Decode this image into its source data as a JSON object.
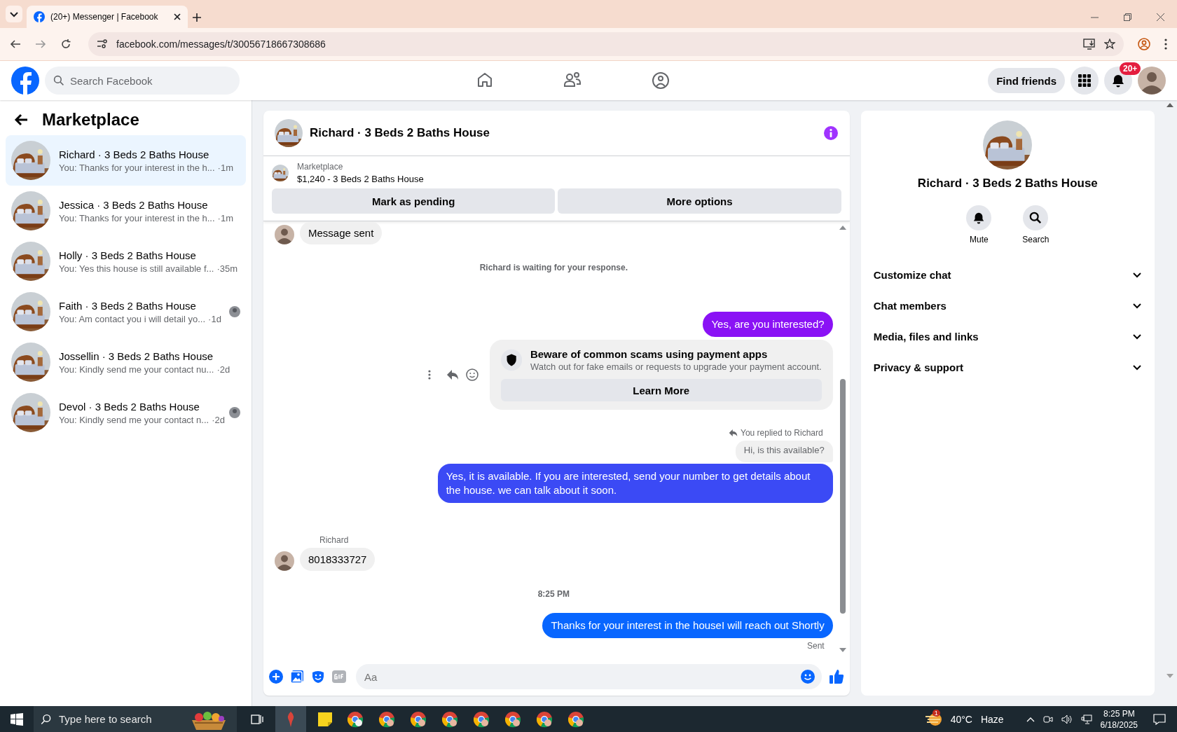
{
  "browser": {
    "tab_title": "(20+) Messenger | Facebook",
    "url": "facebook.com/messages/t/30056718667308686"
  },
  "header": {
    "search_placeholder": "Search Facebook",
    "find_friends": "Find friends",
    "notification_badge": "20+"
  },
  "sidebar": {
    "title": "Marketplace",
    "conversations": [
      {
        "name": "Richard · 3 Beds 2 Baths House",
        "preview": "You: Thanks for your interest in the h...",
        "time": "·1m",
        "selected": true,
        "seen": false
      },
      {
        "name": "Jessica · 3 Beds 2 Baths House",
        "preview": "You: Thanks for your interest in the h...",
        "time": "·1m",
        "selected": false,
        "seen": false
      },
      {
        "name": "Holly · 3 Beds 2 Baths House",
        "preview": "You: Yes this house is still available f...",
        "time": "·35m",
        "selected": false,
        "seen": false
      },
      {
        "name": "Faith · 3 Beds 2 Baths House",
        "preview": "You: Am contact you i will detail yo...",
        "time": "·1d",
        "selected": false,
        "seen": true
      },
      {
        "name": "Jossellin · 3 Beds 2 Baths House",
        "preview": "You: Kindly send me your contact nu...",
        "time": "·2d",
        "selected": false,
        "seen": false
      },
      {
        "name": "Devol · 3 Beds 2 Baths House",
        "preview": "You: Kindly send me your contact n...",
        "time": "·2d",
        "selected": false,
        "seen": true
      }
    ]
  },
  "chat": {
    "title": "Richard · 3 Beds 2 Baths House",
    "listing": {
      "source": "Marketplace",
      "item": "$1,240 - 3 Beds 2 Baths House"
    },
    "buttons": [
      "Mark as pending",
      "More options"
    ],
    "messages": [
      {
        "kind": "incoming",
        "text": "Message sent"
      },
      {
        "kind": "notice",
        "text": "Richard is waiting for your response."
      },
      {
        "kind": "outgoing",
        "text": "Yes, are you interested?",
        "color": "#8a12f5"
      },
      {
        "kind": "safety",
        "title": "Beware of common scams using payment apps",
        "text": "Watch out for fake emails or requests to upgrade your payment account.",
        "button": "Learn More"
      },
      {
        "kind": "reply",
        "text": "You replied to Richard",
        "quote": "Hi, is this available?"
      },
      {
        "kind": "outgoing",
        "text": "Yes, it is available. If you are interested, send your number to get details about the house. we can talk about it soon.",
        "color": "#3b4af5"
      },
      {
        "kind": "incoming",
        "sender": "Richard",
        "text": "8018333727"
      },
      {
        "kind": "time",
        "text": "8:25 PM"
      },
      {
        "kind": "outgoing",
        "text": "Thanks for your interest in the houseI will reach out Shortly",
        "color": "#0866ff"
      },
      {
        "kind": "status",
        "text": "Sent"
      }
    ],
    "composer_placeholder": "Aa"
  },
  "details": {
    "title": "Richard · 3 Beds 2 Baths House",
    "actions": [
      {
        "kind": "bell",
        "label": "Mute"
      },
      {
        "kind": "search",
        "label": "Search"
      }
    ],
    "sections": [
      "Customize chat",
      "Chat members",
      "Media, files and links",
      "Privacy & support"
    ]
  },
  "taskbar": {
    "search_placeholder": "Type here to search",
    "weather_badge": "1",
    "temperature": "40°C",
    "condition": "Haze",
    "time": "8:25 PM",
    "date": "6/18/2025"
  }
}
